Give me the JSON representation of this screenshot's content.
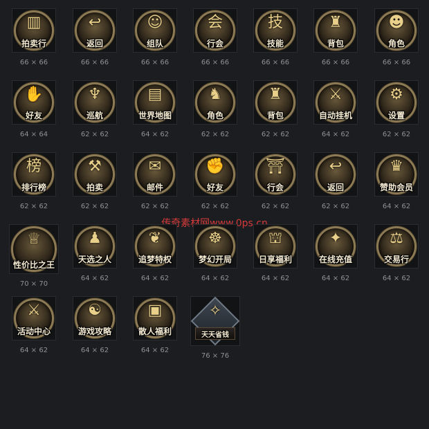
{
  "watermark": "传奇素材网www.0ps.cn",
  "icons": [
    {
      "label": "拍卖行",
      "size": "66 × 66",
      "icon": "auction-house-icon",
      "glyph": "▥"
    },
    {
      "label": "返回",
      "size": "66 × 66",
      "icon": "return-arrow-icon",
      "glyph": "↩"
    },
    {
      "label": "组队",
      "size": "66 × 66",
      "icon": "team-icon",
      "glyph": "☺"
    },
    {
      "label": "行会",
      "size": "66 × 66",
      "icon": "guild-icon",
      "glyph": "会"
    },
    {
      "label": "技能",
      "size": "66 × 66",
      "icon": "skill-icon",
      "glyph": "技"
    },
    {
      "label": "背包",
      "size": "66 × 66",
      "icon": "bag-icon",
      "glyph": "♜"
    },
    {
      "label": "角色",
      "size": "66 × 66",
      "icon": "character-icon",
      "glyph": "☻"
    },
    {
      "label": "好友",
      "size": "64 × 64",
      "icon": "handshake-icon",
      "glyph": "✋"
    },
    {
      "label": "巡航",
      "size": "62 × 62",
      "icon": "cruise-icon",
      "glyph": "♆"
    },
    {
      "label": "世界地图",
      "size": "64 × 62",
      "icon": "world-map-icon",
      "glyph": "▤"
    },
    {
      "label": "角色",
      "size": "62 × 62",
      "icon": "helmet-icon",
      "glyph": "♞"
    },
    {
      "label": "背包",
      "size": "62 × 62",
      "icon": "bag-icon",
      "glyph": "♜"
    },
    {
      "label": "自动挂机",
      "size": "64 × 62",
      "icon": "auto-battle-icon",
      "glyph": "⚔"
    },
    {
      "label": "设置",
      "size": "62 × 62",
      "icon": "gear-icon",
      "glyph": "⚙"
    },
    {
      "label": "排行榜",
      "size": "62 × 62",
      "icon": "ranking-scroll-icon",
      "glyph": "榜"
    },
    {
      "label": "拍卖",
      "size": "62 × 62",
      "icon": "gavel-icon",
      "glyph": "⚒"
    },
    {
      "label": "邮件",
      "size": "62 × 62",
      "icon": "mail-icon",
      "glyph": "✉"
    },
    {
      "label": "好友",
      "size": "62 × 62",
      "icon": "handshake-icon",
      "glyph": "✊"
    },
    {
      "label": "行会",
      "size": "62 × 62",
      "icon": "guild-hall-icon",
      "glyph": "⛩"
    },
    {
      "label": "返回",
      "size": "62 × 62",
      "icon": "return-arrow-icon",
      "glyph": "↩"
    },
    {
      "label": "赞助会员",
      "size": "64 × 62",
      "icon": "sponsor-icon",
      "glyph": "♛"
    },
    {
      "label": "性价比之王",
      "size": "70 × 70",
      "icon": "queen-portrait-icon",
      "glyph": "♕"
    },
    {
      "label": "天选之人",
      "size": "64 × 62",
      "icon": "chosen-one-icon",
      "glyph": "♟"
    },
    {
      "label": "追梦特权",
      "size": "64 × 62",
      "icon": "wing-icon",
      "glyph": "❦"
    },
    {
      "label": "梦幻开局",
      "size": "64 × 62",
      "icon": "meditation-icon",
      "glyph": "☸"
    },
    {
      "label": "日享福利",
      "size": "64 × 62",
      "icon": "golden-gate-icon",
      "glyph": "⛫"
    },
    {
      "label": "在线充值",
      "size": "64 × 62",
      "icon": "treasure-icon",
      "glyph": "✦"
    },
    {
      "label": "交易行",
      "size": "64 × 62",
      "icon": "trade-icon",
      "glyph": "⚖"
    },
    {
      "label": "活动中心",
      "size": "64 × 62",
      "icon": "sword-icon",
      "glyph": "⚔"
    },
    {
      "label": "游戏攻略",
      "size": "64 × 62",
      "icon": "yin-yang-book-icon",
      "glyph": "☯"
    },
    {
      "label": "散人福利",
      "size": "64 × 62",
      "icon": "red-banner-icon",
      "glyph": "▣"
    },
    {
      "label": "天天省钱",
      "size": "76 × 76",
      "icon": "money-scroll-icon",
      "glyph": "✧"
    }
  ]
}
